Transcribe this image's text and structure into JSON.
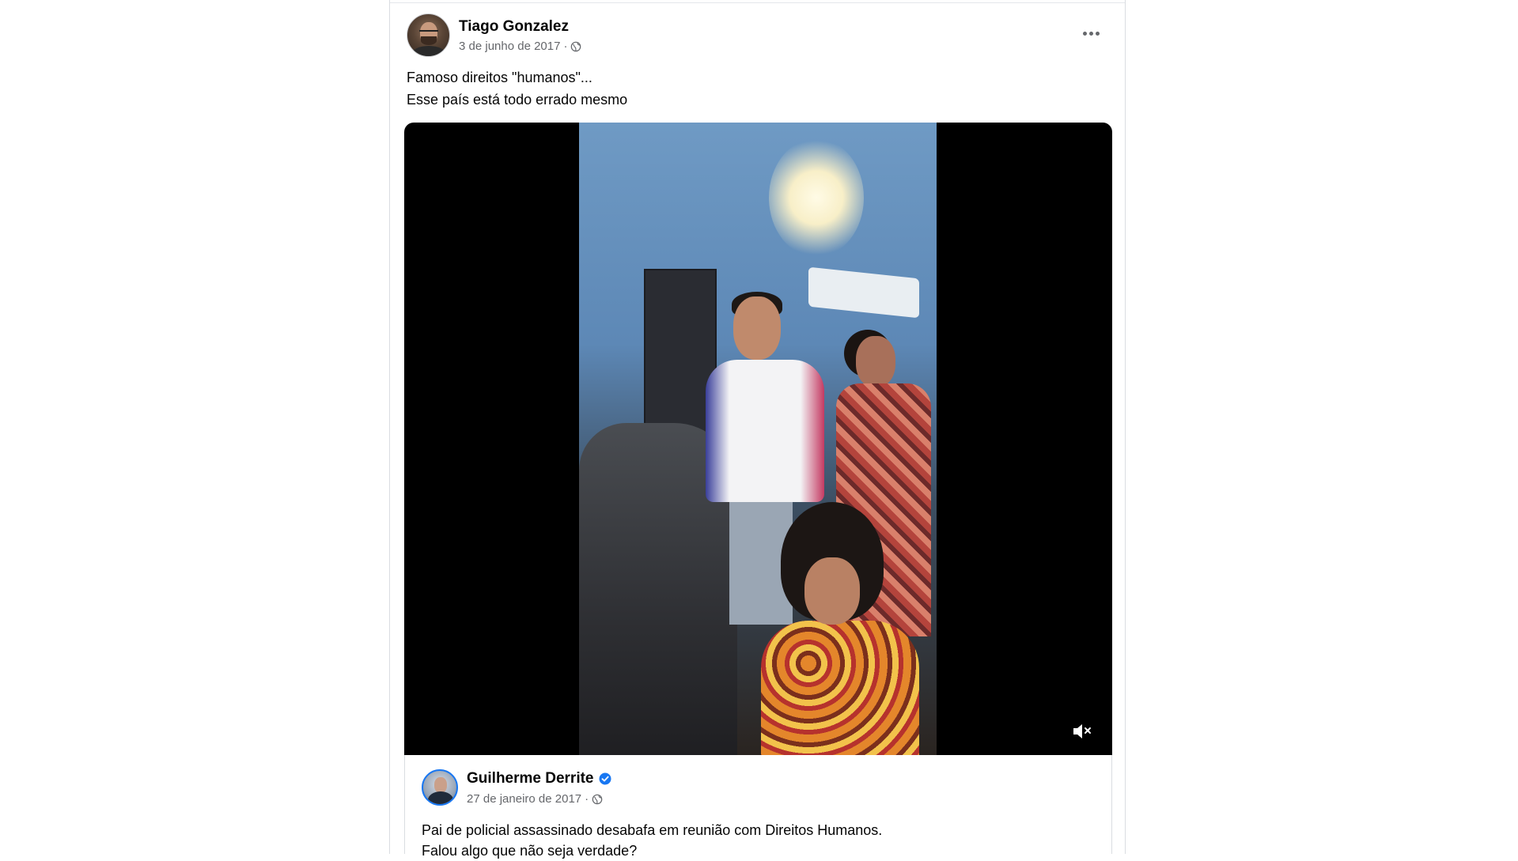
{
  "post": {
    "author": "Tiago Gonzalez",
    "date": "3 de junho de 2017",
    "separator": "·",
    "privacy_icon": "globe-icon",
    "more_icon": "more-options-icon",
    "text_line1": "Famoso direitos \"humanos\"...",
    "text_line2": "Esse país está todo errado mesmo"
  },
  "video": {
    "mute_icon": "muted-speaker-icon"
  },
  "shared_post": {
    "author": "Guilherme Derrite",
    "verified_icon": "verified-badge-icon",
    "date": "27 de janeiro de 2017",
    "separator": "·",
    "privacy_icon": "globe-icon",
    "text_line1": "Pai de policial assassinado desabafa em reunião com Direitos Humanos.",
    "text_line2": "Falou algo que não seja verdade?"
  },
  "colors": {
    "accent": "#1877f2",
    "secondary_text": "#65676b",
    "primary_text": "#050505",
    "video_background": "#000000"
  }
}
